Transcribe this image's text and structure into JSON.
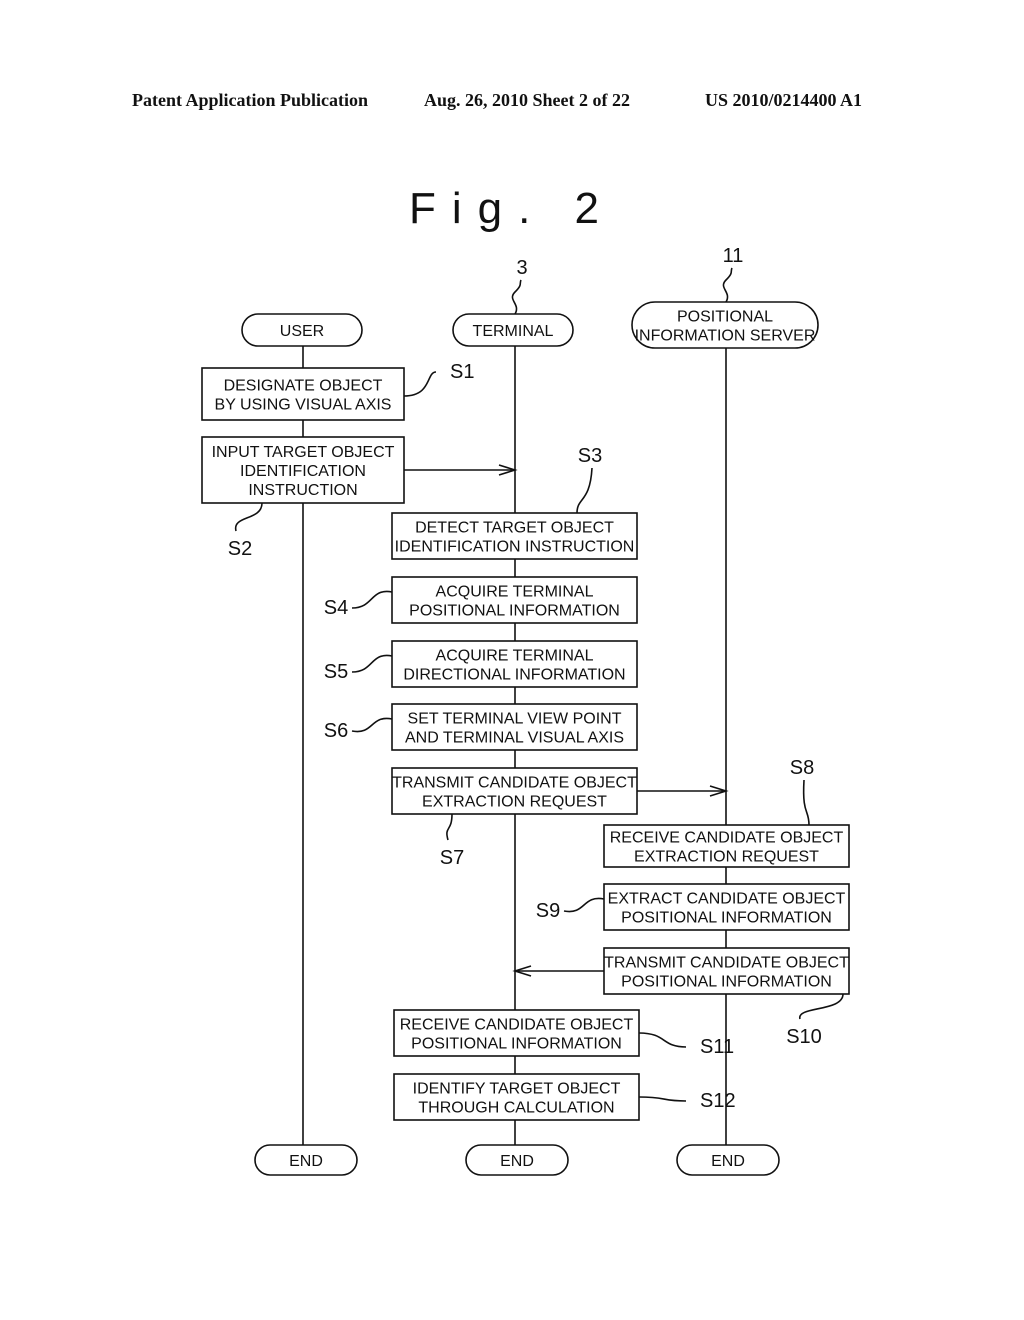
{
  "header": {
    "left": "Patent Application Publication",
    "middle": "Aug. 26, 2010  Sheet 2 of 22",
    "right": "US 2010/0214400 A1"
  },
  "figure_title": "Fig. 2",
  "lanes": [
    {
      "id": "user",
      "label_lines": [
        "USER"
      ],
      "ref": ""
    },
    {
      "id": "terminal",
      "label_lines": [
        "TERMINAL"
      ],
      "ref": "3"
    },
    {
      "id": "server",
      "label_lines": [
        "POSITIONAL",
        "INFORMATION SERVER"
      ],
      "ref": "11"
    }
  ],
  "steps": [
    {
      "id": "S1",
      "lane": "user",
      "lines": [
        "DESIGNATE OBJECT",
        "BY USING VISUAL AXIS"
      ]
    },
    {
      "id": "S2",
      "lane": "user",
      "lines": [
        "INPUT TARGET OBJECT",
        "IDENTIFICATION",
        "INSTRUCTION"
      ]
    },
    {
      "id": "S3",
      "lane": "terminal",
      "lines": [
        "DETECT TARGET OBJECT",
        "IDENTIFICATION INSTRUCTION"
      ]
    },
    {
      "id": "S4",
      "lane": "terminal",
      "lines": [
        "ACQUIRE TERMINAL",
        "POSITIONAL INFORMATION"
      ]
    },
    {
      "id": "S5",
      "lane": "terminal",
      "lines": [
        "ACQUIRE TERMINAL",
        "DIRECTIONAL INFORMATION"
      ]
    },
    {
      "id": "S6",
      "lane": "terminal",
      "lines": [
        "SET TERMINAL VIEW POINT",
        "AND TERMINAL VISUAL AXIS"
      ]
    },
    {
      "id": "S7",
      "lane": "terminal",
      "lines": [
        "TRANSMIT CANDIDATE OBJECT",
        "EXTRACTION REQUEST"
      ]
    },
    {
      "id": "S8",
      "lane": "server",
      "lines": [
        "RECEIVE CANDIDATE OBJECT",
        "EXTRACTION REQUEST"
      ]
    },
    {
      "id": "S9",
      "lane": "server",
      "lines": [
        "EXTRACT CANDIDATE OBJECT",
        "POSITIONAL INFORMATION"
      ]
    },
    {
      "id": "S10",
      "lane": "server",
      "lines": [
        "TRANSMIT CANDIDATE OBJECT",
        "POSITIONAL INFORMATION"
      ]
    },
    {
      "id": "S11",
      "lane": "terminal",
      "lines": [
        "RECEIVE CANDIDATE OBJECT",
        "POSITIONAL INFORMATION"
      ]
    },
    {
      "id": "S12",
      "lane": "terminal",
      "lines": [
        "IDENTIFY TARGET OBJECT",
        "THROUGH CALCULATION"
      ]
    }
  ],
  "messages": [
    {
      "from": "S2",
      "to": "terminal"
    },
    {
      "from": "S7",
      "to": "server"
    },
    {
      "from": "S10",
      "to": "terminal"
    }
  ],
  "end_label": "END"
}
